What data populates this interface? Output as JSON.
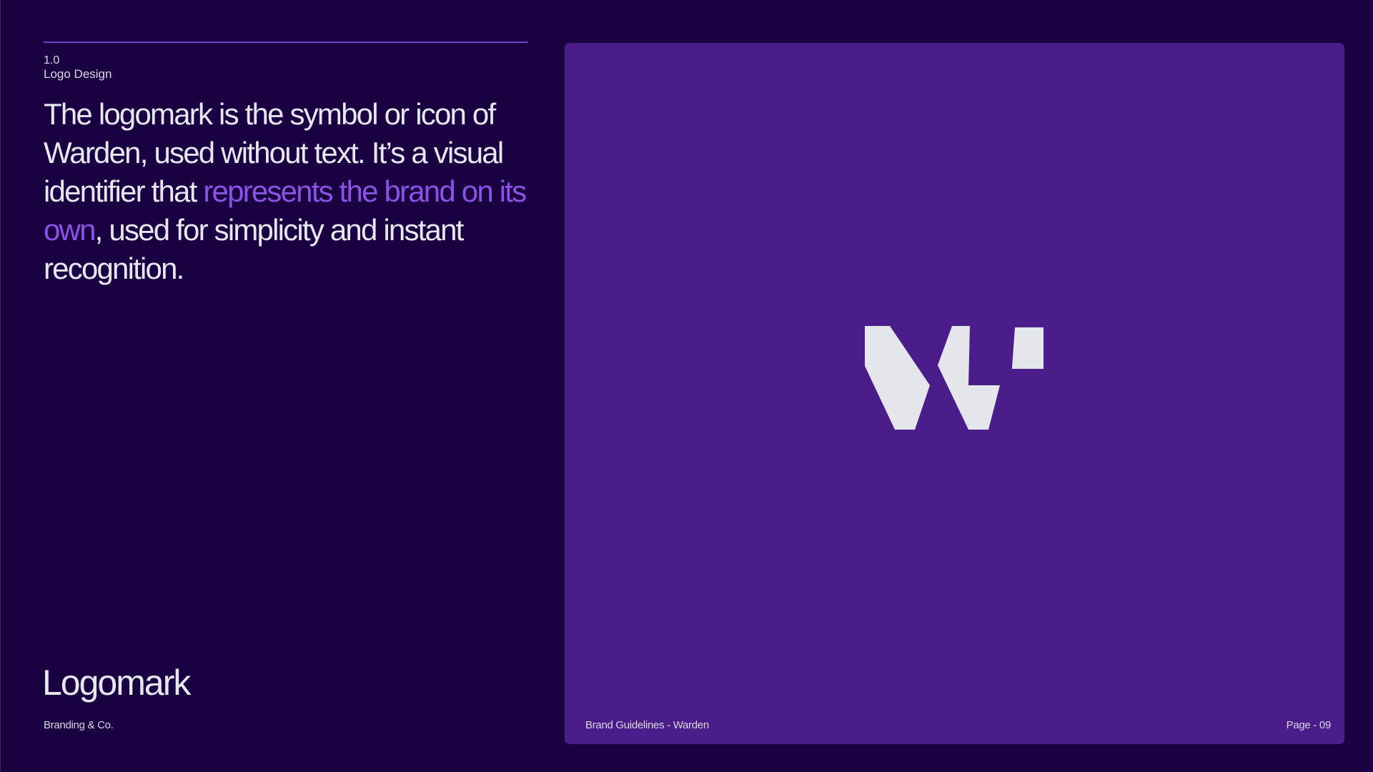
{
  "section": {
    "number": "1.0",
    "title": "Logo Design"
  },
  "description": {
    "part1": "The logomark is the symbol or icon of Warden, used without text. It’s a visual identifier that ",
    "highlight": "represents the brand on its own",
    "part2": ", used for simplicity and instant recognition."
  },
  "heading": "Logomark",
  "footer": {
    "company": "Branding & Co.",
    "document": "Brand Guidelines - Warden",
    "page": "Page - 09"
  },
  "logo": {
    "icon": "warden-w-logomark-icon",
    "color": "#e4e6eb",
    "background": "#4a1d8a"
  },
  "colors": {
    "page_background": "#1a0142",
    "accent": "#8b52e6",
    "rule": "#6b3fd0",
    "text": "#e7e8ef"
  }
}
